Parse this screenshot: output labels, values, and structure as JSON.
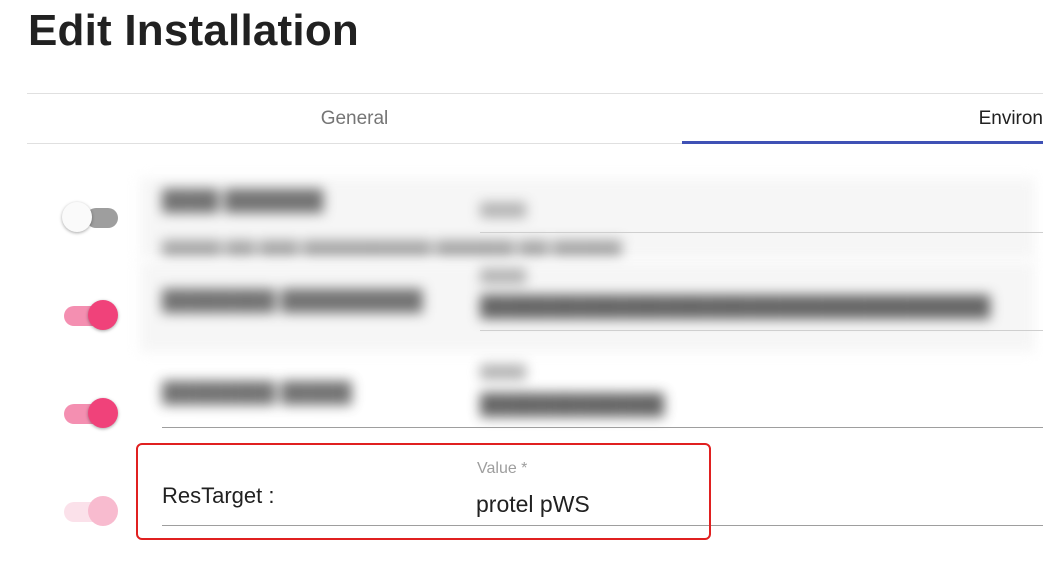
{
  "page": {
    "title": "Edit Installation"
  },
  "tabs": [
    {
      "label": "General",
      "active": false
    },
    {
      "label": "Environ",
      "active": true
    }
  ],
  "colors": {
    "accent": "#3f51b5",
    "toggle_on": "#f0427a",
    "highlight": "#e02020"
  },
  "rows": [
    {
      "toggle": "off",
      "blurred": true
    },
    {
      "toggle": "on",
      "blurred": true
    },
    {
      "toggle": "on",
      "blurred": true
    },
    {
      "toggle": "disabled-on",
      "blurred": false,
      "key": "ResTarget :",
      "value_label": "Value *",
      "value": "protel pWS"
    }
  ]
}
